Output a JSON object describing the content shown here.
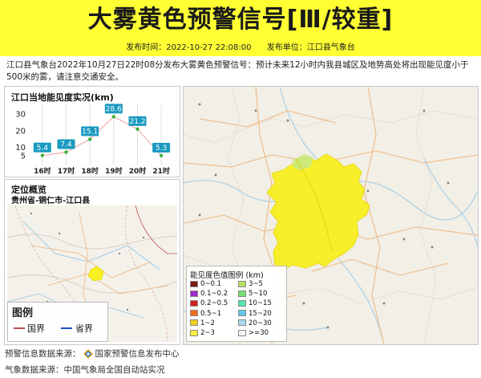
{
  "header": {
    "title": "大雾黄色预警信号[Ⅲ/较重]",
    "publish_time_label": "发布时间：2022-10-27 22:08:00",
    "publish_unit_label": "发布单位：江口县气象台",
    "banner_color": "#ffff33"
  },
  "description": "江口县气象台2022年10月27日22时08分发布大雾黄色预警信号：预计未来12小时内我县城区及地势高处将出现能见度小于500米的雾，请注意交通安全。",
  "chart_panel": {
    "title": "江口当地能见度实况(km)"
  },
  "chart_data": {
    "type": "line",
    "categories": [
      "16时",
      "17时",
      "18时",
      "19时",
      "20时",
      "21时"
    ],
    "values": [
      5.4,
      7.4,
      15.1,
      28.6,
      21.2,
      5.3
    ],
    "y_ticks": [
      "5",
      "10",
      "20",
      "30"
    ],
    "ylim": [
      0,
      36
    ],
    "data_labels": [
      "5.4",
      "7.4",
      "15.1",
      "28.6",
      "21.2",
      "5.3"
    ],
    "line_color": "#f2b8b8",
    "label_bg": "#1a9ac0",
    "point_color": "#3cb43c",
    "grid": true
  },
  "location_panel": {
    "title": "定位概览",
    "region": "贵州省-铜仁市-江口县",
    "legend_title": "图例",
    "legend_items": [
      "国界",
      "省界"
    ],
    "legend_colors": [
      "#c05050",
      "#2050c0"
    ]
  },
  "visibility_legend": {
    "title": "能见度色值图例 (km)",
    "items": [
      {
        "label": "0~0.1",
        "color": "#7a1a10"
      },
      {
        "label": "3~5",
        "color": "#b8e060"
      },
      {
        "label": "0.1~0.2",
        "color": "#9a2ac8"
      },
      {
        "label": "5~10",
        "color": "#78e070"
      },
      {
        "label": "0.2~0.5",
        "color": "#d02020"
      },
      {
        "label": "10~15",
        "color": "#50e8b0"
      },
      {
        "label": "0.5~1",
        "color": "#f07020"
      },
      {
        "label": "15~20",
        "color": "#60c8e8"
      },
      {
        "label": "1~2",
        "color": "#f0d020"
      },
      {
        "label": "20~30",
        "color": "#a8d8f0"
      },
      {
        "label": "2~3",
        "color": "#f8f040"
      },
      {
        "label": ">=30",
        "color": "#f4f4f4"
      }
    ]
  },
  "sources": {
    "warning_label": "预警信息数据来源：",
    "warning_value": "国家预警信息发布中心",
    "weather_label": "气象数据来源：",
    "weather_value": "中国气象局全国自动站实况"
  },
  "map_colors": {
    "fog_yellow": "#f8f020",
    "fog_green": "#c8e880",
    "road": "#f0c090",
    "river": "#a8d8f0",
    "land": "#f2efe6"
  }
}
